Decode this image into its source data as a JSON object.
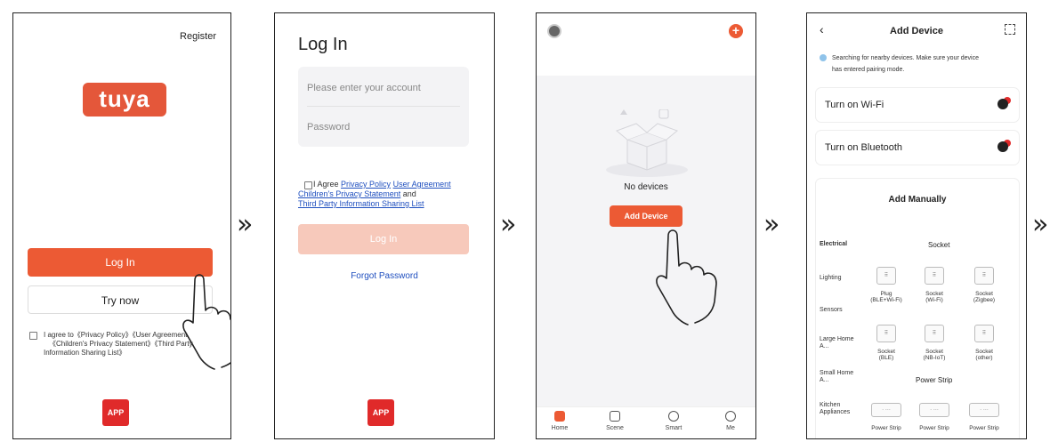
{
  "arrows": {
    "glyph": "»"
  },
  "panel1": {
    "register": "Register",
    "logo": "tuya",
    "login_button": "Log In",
    "try_now": "Try now",
    "agree_line1": "I agree to《Privacy Policy》《User Agreement",
    "agree_line2": "《Children's Privacy Statement》《Third Party",
    "agree_line3": "Information Sharing List》",
    "app_badge": "APP"
  },
  "panel2": {
    "title": "Log In",
    "account_placeholder": "Please enter your account",
    "password_placeholder": "Password",
    "agree_prefix": "I Agree",
    "privacy_policy": "Privacy Policy",
    "user_agreement": "User Agreement",
    "children_statement": "Children's Privacy Statement",
    "and": "and",
    "third_party": "Third Party Information Sharing List",
    "login_button": "Log In",
    "forgot": "Forgot Password",
    "app_badge": "APP"
  },
  "panel3": {
    "empty_text": "No devices",
    "add_device": "Add Device",
    "tabs": [
      "Home",
      "Scene",
      "Smart",
      "Me"
    ]
  },
  "panel4": {
    "title": "Add Device",
    "searching_line1": "Searching for nearby devices. Make sure your device",
    "searching_line2": "has entered pairing mode.",
    "wifi": "Turn on Wi-Fi",
    "bluetooth": "Turn on Bluetooth",
    "add_manually": "Add Manually",
    "socket_header": "Socket",
    "categories": [
      "Electrical",
      "Lighting",
      "Sensors",
      "Large Home A...",
      "Small Home A...",
      "Kitchen Appliances"
    ],
    "row1": [
      [
        "Plug",
        "(BLE+Wi-Fi)"
      ],
      [
        "Socket",
        "(Wi-Fi)"
      ],
      [
        "Socket",
        "(Zigbee)"
      ]
    ],
    "row2": [
      [
        "Socket",
        "(BLE)"
      ],
      [
        "Socket",
        "(NB-IoT)"
      ],
      [
        "Socket",
        "(other)"
      ]
    ],
    "power_strip_header": "Power Strip",
    "row3": [
      "Power Strip",
      "Power Strip",
      "Power Strip"
    ]
  },
  "colors": {
    "accent": "#ec5a34",
    "link": "#1f4fbf",
    "logo": "#e4573a",
    "app_badge": "#e02a2a"
  }
}
